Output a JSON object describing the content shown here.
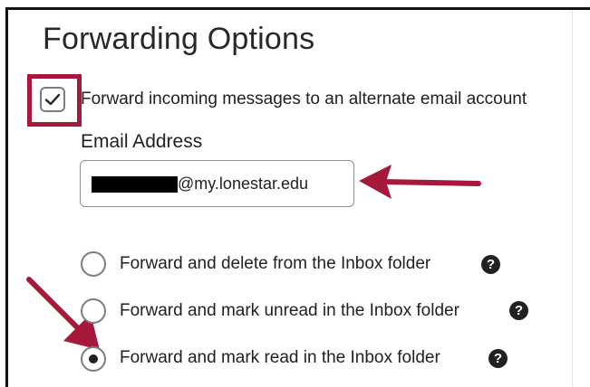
{
  "page": {
    "title": "Forwarding Options"
  },
  "forward_checkbox": {
    "label": "Forward incoming messages to an alternate email account",
    "checked": true
  },
  "email": {
    "label": "Email Address",
    "value": "@my.lonestar.edu"
  },
  "radio_options": [
    {
      "label": "Forward and delete from the Inbox folder",
      "selected": false
    },
    {
      "label": "Forward and mark unread in the Inbox folder",
      "selected": false
    },
    {
      "label": "Forward and mark read in the Inbox folder",
      "selected": true
    }
  ],
  "icons": {
    "help": "question-mark-circle-icon",
    "check": "checkmark-icon",
    "annotation": "red-arrow-icon"
  },
  "colors": {
    "annotation_red": "#a6193a",
    "text": "#202122",
    "border": "#7a7d82"
  }
}
